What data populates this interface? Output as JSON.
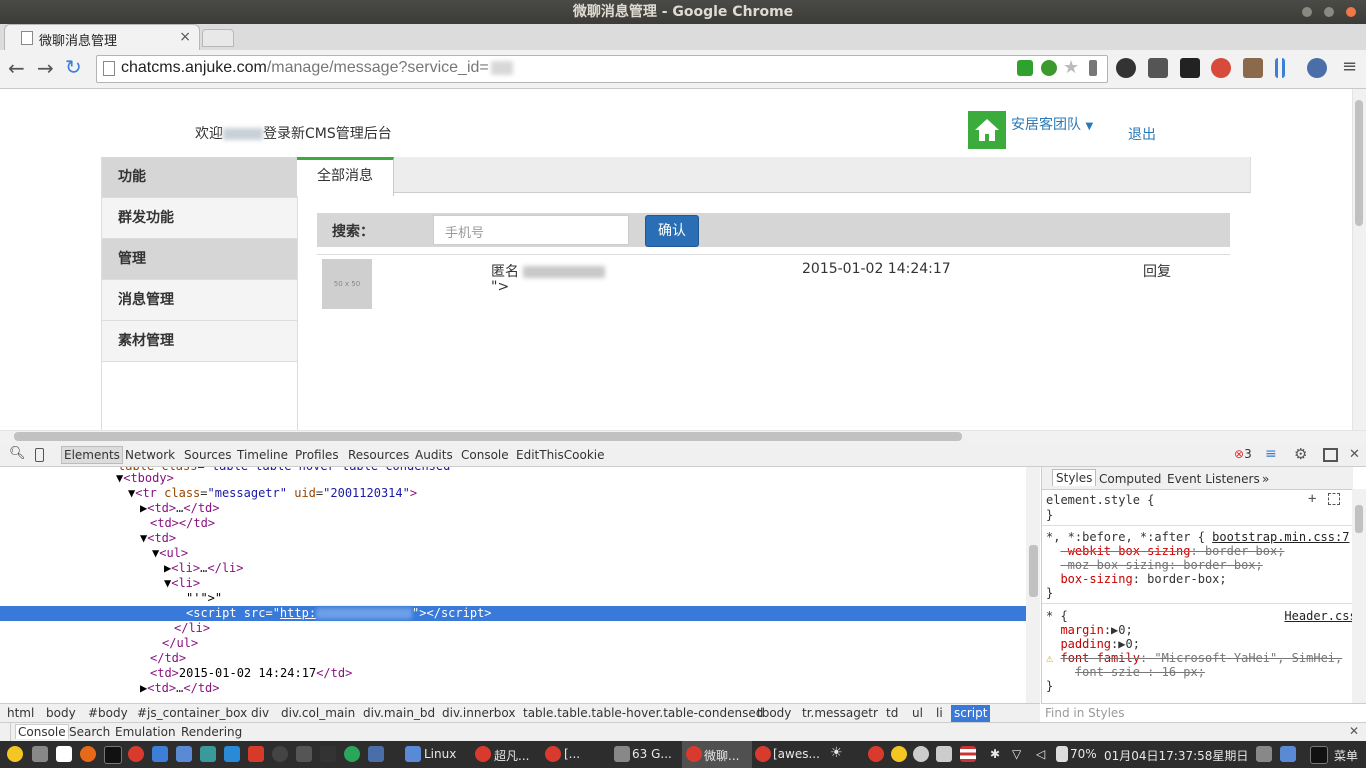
{
  "window": {
    "title": "微聊消息管理 - Google Chrome"
  },
  "browser": {
    "tab_title": "微聊消息管理",
    "tab_close": "×",
    "url_host": "chatcms.anjuke.com",
    "url_path": "/manage/message?service_id="
  },
  "page": {
    "welcome_prefix": "欢迎",
    "welcome_suffix": "登录新CMS管理后台",
    "team": "安居客团队",
    "logout": "退出",
    "sidebar": [
      {
        "label": "功能",
        "header": true
      },
      {
        "label": "群发功能",
        "header": false
      },
      {
        "label": "管理",
        "header": true
      },
      {
        "label": "消息管理",
        "header": false
      },
      {
        "label": "素材管理",
        "header": false
      }
    ],
    "tab": "全部消息",
    "search_label": "搜索：",
    "search_placeholder": "手机号",
    "confirm_button": "确认",
    "message": {
      "thumb_text": "50 x 50",
      "sender": "匿名",
      "content": "\">",
      "time": "2015-01-02 14:24:17",
      "reply": "回复"
    }
  },
  "devtools": {
    "tabs": [
      "Elements",
      "Network",
      "Sources",
      "Timeline",
      "Profiles",
      "Resources",
      "Audits",
      "Console",
      "EditThisCookie"
    ],
    "error_count": "3",
    "style_tabs": [
      "Styles",
      "Computed",
      "Event Listeners",
      "»"
    ],
    "breadcrumbs": [
      "html",
      "body",
      "#body",
      "#js_container_box",
      "div",
      "div.col_main",
      "div.main_bd",
      "div.innerbox",
      "table.table.table-hover.table-condensed",
      "tbody",
      "tr.messagetr",
      "td",
      "ul",
      "li",
      "script"
    ],
    "find_placeholder": "Find in Styles",
    "drawer_tabs": [
      "Console",
      "Search",
      "Emulation",
      "Rendering"
    ]
  },
  "taskbar": {
    "items": [
      "Linux",
      "超凡...",
      "[...",
      "63 G...",
      "微聊...",
      "[awes..."
    ],
    "status": "70%",
    "clock": "01月04日17:37:58星期日",
    "menu": "菜单"
  }
}
